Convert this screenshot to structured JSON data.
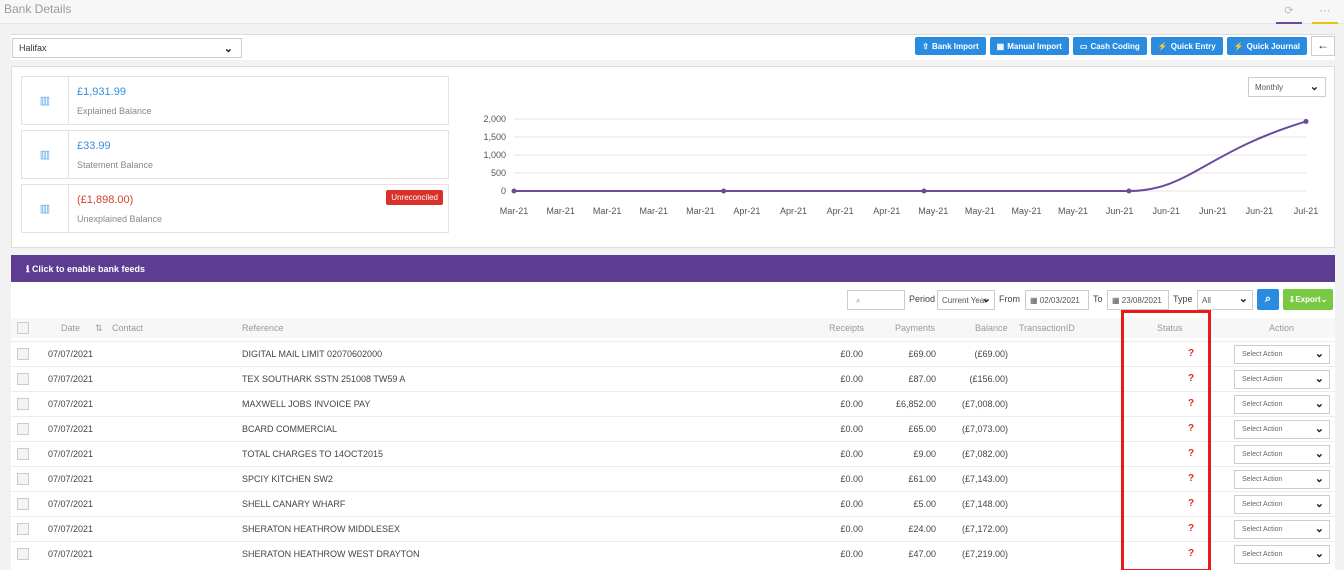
{
  "page": {
    "title": "Bank Details"
  },
  "colors": {
    "primary": "#2a8ce0",
    "purple": "#5c3d91",
    "green": "#7ac943",
    "danger": "#d8312a"
  },
  "toolbar": {
    "bank_value": "Halifax",
    "buttons": [
      {
        "icon": "upload-icon",
        "label": "Bank Import"
      },
      {
        "icon": "grid-icon",
        "label": "Manual Import"
      },
      {
        "icon": "card-icon",
        "label": "Cash Coding"
      },
      {
        "icon": "bolt-icon",
        "label": "Quick Entry"
      },
      {
        "icon": "bolt-icon",
        "label": "Quick Journal"
      }
    ],
    "back_glyph": "←"
  },
  "summary": {
    "cards": [
      {
        "amount": "£1,931.99",
        "label": "Explained Balance",
        "negative": false
      },
      {
        "amount": "£33.99",
        "label": "Statement Balance",
        "negative": false
      },
      {
        "amount": "(£1,898.00)",
        "label": "Unexplained Balance",
        "negative": true,
        "badge": "Unreconciled"
      }
    ],
    "period": "Monthly"
  },
  "chart_data": {
    "type": "line",
    "categories": [
      "Mar-21",
      "Mar-21",
      "Mar-21",
      "Mar-21",
      "Mar-21",
      "Apr-21",
      "Apr-21",
      "Apr-21",
      "Apr-21",
      "May-21",
      "May-21",
      "May-21",
      "May-21",
      "Jun-21",
      "Jun-21",
      "Jun-21",
      "Jun-21",
      "Jul-21"
    ],
    "yticks": [
      "0",
      "500",
      "1,000",
      "1,500",
      "2,000"
    ],
    "ylim": [
      0,
      2000
    ],
    "points": [
      {
        "i": 0,
        "y": 0
      },
      {
        "i": 4.5,
        "y": 0
      },
      {
        "i": 8.8,
        "y": 0
      },
      {
        "i": 13.2,
        "y": 0
      },
      {
        "i": 17,
        "y": 1931.99
      }
    ],
    "color": "#6a4c9c",
    "grid": true
  },
  "feeds": {
    "text": "Click to enable bank feeds",
    "icon": "info-icon"
  },
  "filters": {
    "search_placeholder": "",
    "period_label": "Period",
    "period_value": "Current Year",
    "from_label": "From",
    "from_value": "02/03/2021",
    "to_label": "To",
    "to_value": "23/08/2021",
    "type_label": "Type",
    "type_value": "All",
    "export_label": "Export"
  },
  "table": {
    "headers": {
      "date": "Date",
      "contact": "Contact",
      "reference": "Reference",
      "receipts": "Receipts",
      "payments": "Payments",
      "balance": "Balance",
      "transaction_id": "TransactionID",
      "status": "Status",
      "action": "Action"
    },
    "action_placeholder": "Select Action",
    "status_glyph": "?",
    "rows": [
      {
        "date": "07/07/2021",
        "reference": "DIGITAL MAIL LIMIT 02070602000",
        "receipts": "£0.00",
        "payments": "£69.00",
        "balance": "(£69.00)"
      },
      {
        "date": "07/07/2021",
        "reference": "TEX SOUTHARK SSTN 251008 TW59 A",
        "receipts": "£0.00",
        "payments": "£87.00",
        "balance": "(£156.00)"
      },
      {
        "date": "07/07/2021",
        "reference": "MAXWELL JOBS INVOICE PAY",
        "receipts": "£0.00",
        "payments": "£6,852.00",
        "balance": "(£7,008.00)"
      },
      {
        "date": "07/07/2021",
        "reference": "BCARD COMMERCIAL",
        "receipts": "£0.00",
        "payments": "£65.00",
        "balance": "(£7,073.00)"
      },
      {
        "date": "07/07/2021",
        "reference": "TOTAL CHARGES TO 14OCT2015",
        "receipts": "£0.00",
        "payments": "£9.00",
        "balance": "(£7,082.00)"
      },
      {
        "date": "07/07/2021",
        "reference": "SPCIY KITCHEN SW2",
        "receipts": "£0.00",
        "payments": "£61.00",
        "balance": "(£7,143.00)"
      },
      {
        "date": "07/07/2021",
        "reference": "SHELL CANARY WHARF",
        "receipts": "£0.00",
        "payments": "£5.00",
        "balance": "(£7,148.00)"
      },
      {
        "date": "07/07/2021",
        "reference": "SHERATON HEATHROW MIDDLESEX",
        "receipts": "£0.00",
        "payments": "£24.00",
        "balance": "(£7,172.00)"
      },
      {
        "date": "07/07/2021",
        "reference": "SHERATON HEATHROW WEST DRAYTON",
        "receipts": "£0.00",
        "payments": "£47.00",
        "balance": "(£7,219.00)"
      }
    ]
  }
}
